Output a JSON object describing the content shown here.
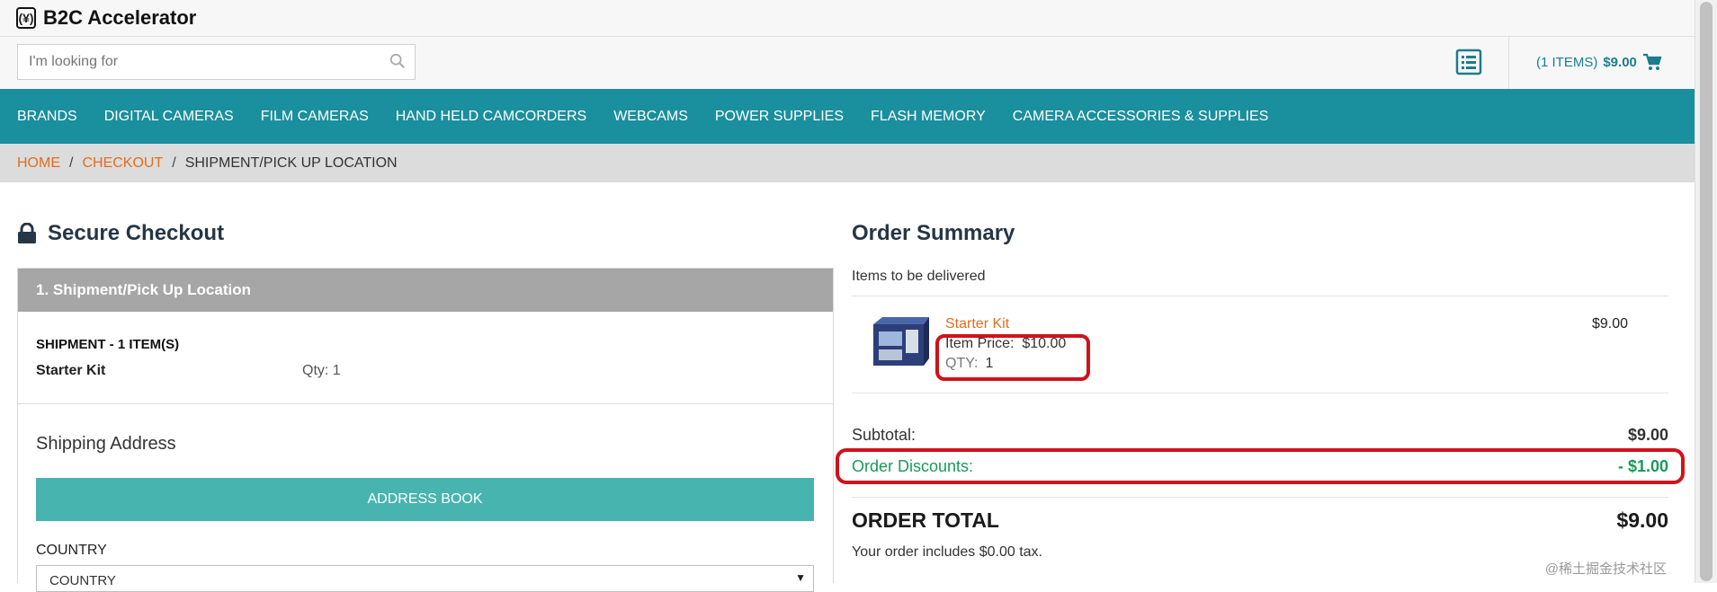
{
  "brand": {
    "name": "B2C Accelerator",
    "mark": "(¥)"
  },
  "search": {
    "placeholder": "I'm looking for"
  },
  "cart": {
    "items_label": "(1 ITEMS)",
    "amount": "$9.00"
  },
  "nav": [
    "BRANDS",
    "DIGITAL CAMERAS",
    "FILM CAMERAS",
    "HAND HELD CAMCORDERS",
    "WEBCAMS",
    "POWER SUPPLIES",
    "FLASH MEMORY",
    "CAMERA ACCESSORIES & SUPPLIES"
  ],
  "breadcrumb": {
    "home": "HOME",
    "sep": "/",
    "checkout": "CHECKOUT",
    "current": "SHIPMENT/PICK UP LOCATION"
  },
  "checkout": {
    "title": "Secure Checkout",
    "step_header": "1. Shipment/Pick Up Location",
    "shipment_title": "SHIPMENT - 1 ITEM(S)",
    "item_name": "Starter Kit",
    "item_qty": "Qty: 1",
    "shipping_address": "Shipping Address",
    "address_book_button": "ADDRESS BOOK",
    "country_label": "COUNTRY",
    "country_select": "COUNTRY"
  },
  "summary": {
    "title": "Order Summary",
    "subtitle": "Items to be delivered",
    "product": {
      "name": "Starter Kit",
      "price_label": "Item Price:",
      "price": "$10.00",
      "qty_label": "QTY:",
      "qty": "1",
      "total": "$9.00"
    },
    "subtotal_label": "Subtotal:",
    "subtotal": "$9.00",
    "discount_label": "Order Discounts:",
    "discount": "- $1.00",
    "total_label": "ORDER TOTAL",
    "total": "$9.00",
    "tax_note": "Your order includes $0.00 tax."
  },
  "watermark": "@稀土掘金技术社区",
  "colors": {
    "teal_nav": "#1a8f9d",
    "button_teal": "#48b4b0",
    "orange_link": "#e36d1c",
    "discount_green": "#1a9a58",
    "highlight_red": "#d0121a"
  }
}
